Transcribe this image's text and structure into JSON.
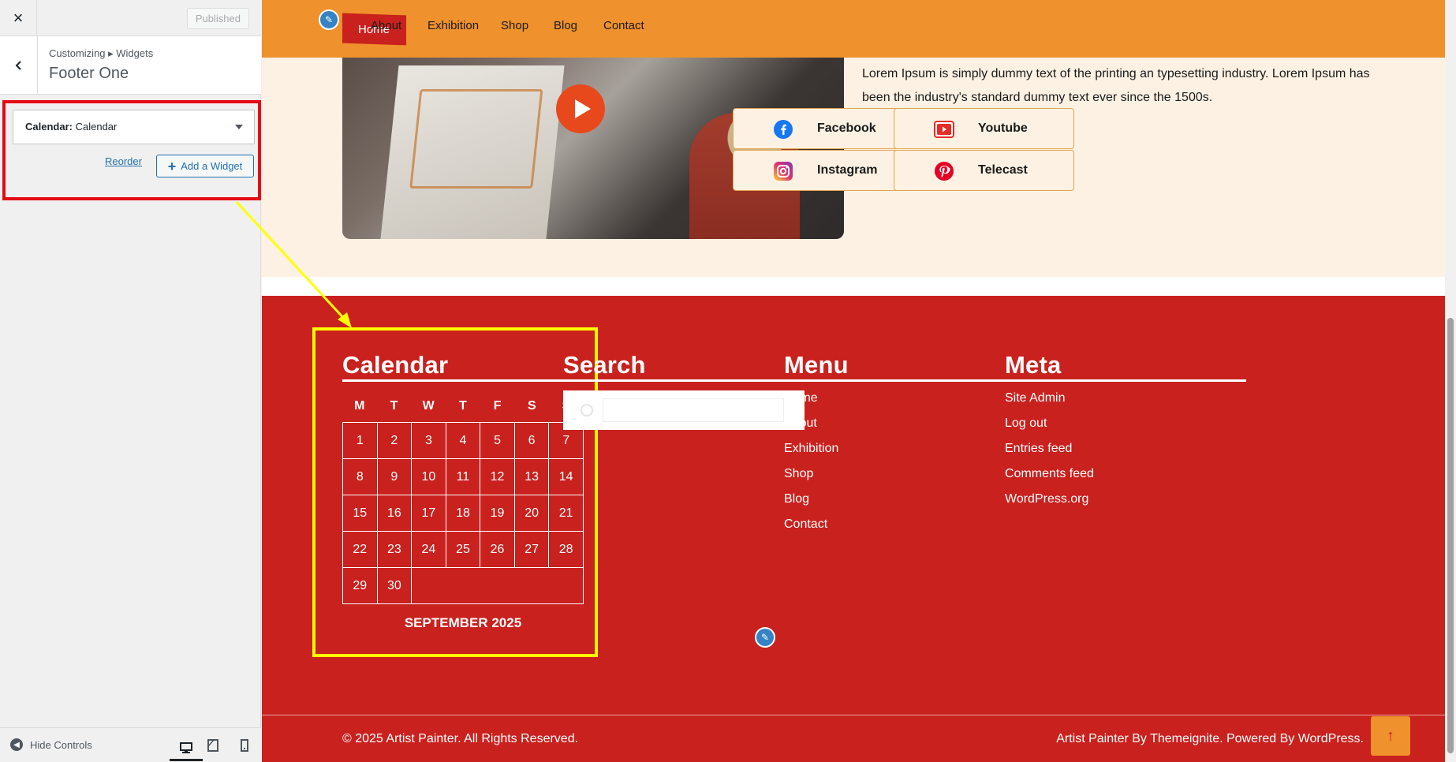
{
  "sidebar": {
    "close_label": "×",
    "published_label": "Published",
    "breadcrumb": "Customizing ▸ Widgets",
    "section_title": "Footer One",
    "widget": {
      "type": "Calendar",
      "name": "Calendar"
    },
    "reorder_label": "Reorder",
    "add_widget_label": "Add a Widget",
    "hide_controls_label": "Hide Controls"
  },
  "nav": {
    "items": [
      "Home",
      "About",
      "Exhibition",
      "Shop",
      "Blog",
      "Contact"
    ],
    "active": "Home"
  },
  "hero": {
    "text": "Lorem Ipsum is simply dummy text of the printing an typesetting industry. Lorem Ipsum has been the industry's standard dummy text ever since the 1500s.",
    "social": [
      "Facebook",
      "Youtube",
      "Instagram",
      "Telecast"
    ]
  },
  "footer": {
    "calendar_title": "Calendar",
    "days_of_week": [
      "M",
      "T",
      "W",
      "T",
      "F",
      "S",
      "S"
    ],
    "month_label": "SEPTEMBER 2025",
    "weeks": [
      [
        "1",
        "2",
        "3",
        "4",
        "5",
        "6",
        "7"
      ],
      [
        "8",
        "9",
        "10",
        "11",
        "12",
        "13",
        "14"
      ],
      [
        "15",
        "16",
        "17",
        "18",
        "19",
        "20",
        "21"
      ],
      [
        "22",
        "23",
        "24",
        "25",
        "26",
        "27",
        "28"
      ],
      [
        "29",
        "30",
        "",
        "",
        "",
        "",
        ""
      ]
    ],
    "search_title": "Search",
    "menu_title": "Menu",
    "menu_items": [
      "Home",
      "About",
      "Exhibition",
      "Shop",
      "Blog",
      "Contact"
    ],
    "meta_title": "Meta",
    "meta_items": [
      "Site Admin",
      "Log out",
      "Entries feed",
      "Comments feed",
      "WordPress.org"
    ],
    "copyright": "© 2025 Artist Painter. All Rights Reserved.",
    "credit": "Artist Painter By Themeignite. Powered By WordPress."
  },
  "colors": {
    "nav_bg": "#ef912c",
    "footer_bg": "#c9211e",
    "highlight_red": "#e50914",
    "highlight_yellow": "#ffff00"
  }
}
